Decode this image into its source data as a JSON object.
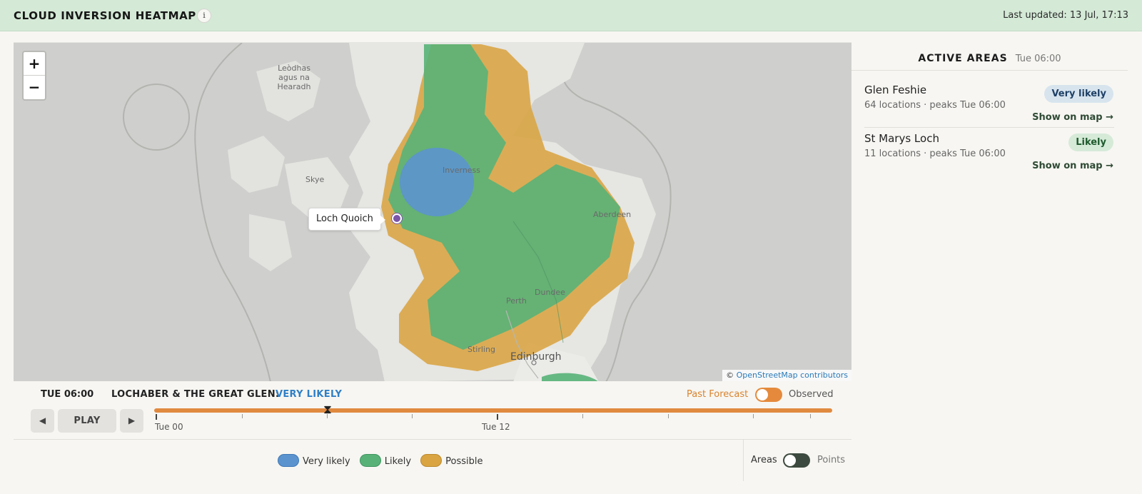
{
  "header": {
    "title": "CLOUD INVERSION HEATMAP",
    "info_glyph": "i",
    "last_updated": "Last updated: 13 Jul, 17:13"
  },
  "map": {
    "zoom_in": "+",
    "zoom_out": "−",
    "labels": {
      "lewis": "Leòdhas agus na Hearadh",
      "skye": "Skye",
      "inverness": "Inverness",
      "aberdeen": "Aberdeen",
      "perth": "Perth",
      "dundee": "Dundee",
      "stirling": "Stirling",
      "edinburgh": "Edinburgh"
    },
    "callout": "Loch Quoich",
    "attribution_prefix": "©",
    "attribution_link": "OpenStreetMap contributors"
  },
  "timeline": {
    "current_time": "TUE 06:00",
    "area_label": "LOCHABER & THE GREAT GLEN:",
    "area_status": "VERY LIKELY",
    "past_label": "Past Forecast",
    "observed_label": "Observed",
    "prev_glyph": "◀",
    "play_label": "PLAY",
    "next_glyph": "▶",
    "thumb_glyph": "⧗",
    "tick_labels": {
      "start": "Tue 00",
      "mid": "Tue 12"
    },
    "position_fraction": 0.26
  },
  "legend": {
    "items": [
      {
        "label": "Very likely",
        "color": "#5b93cf"
      },
      {
        "label": "Likely",
        "color": "#58b278"
      },
      {
        "label": "Possible",
        "color": "#d9a441"
      }
    ],
    "areas_label": "Areas",
    "points_label": "Points"
  },
  "panel": {
    "title": "ACTIVE AREAS",
    "time": "Tue 06:00",
    "areas": [
      {
        "name": "Glen Feshie",
        "meta": "64 locations · peaks Tue 06:00",
        "badge": "Very likely",
        "link": "Show on map →"
      },
      {
        "name": "St Marys Loch",
        "meta": "11 locations · peaks Tue 06:00",
        "badge": "Likely",
        "link": "Show on map →"
      }
    ]
  },
  "colors": {
    "header_bg": "#d4e9d6",
    "accent_orange": "#e08a40",
    "very_likely": "#5b93cf",
    "likely": "#58b278",
    "possible": "#d9a441"
  }
}
